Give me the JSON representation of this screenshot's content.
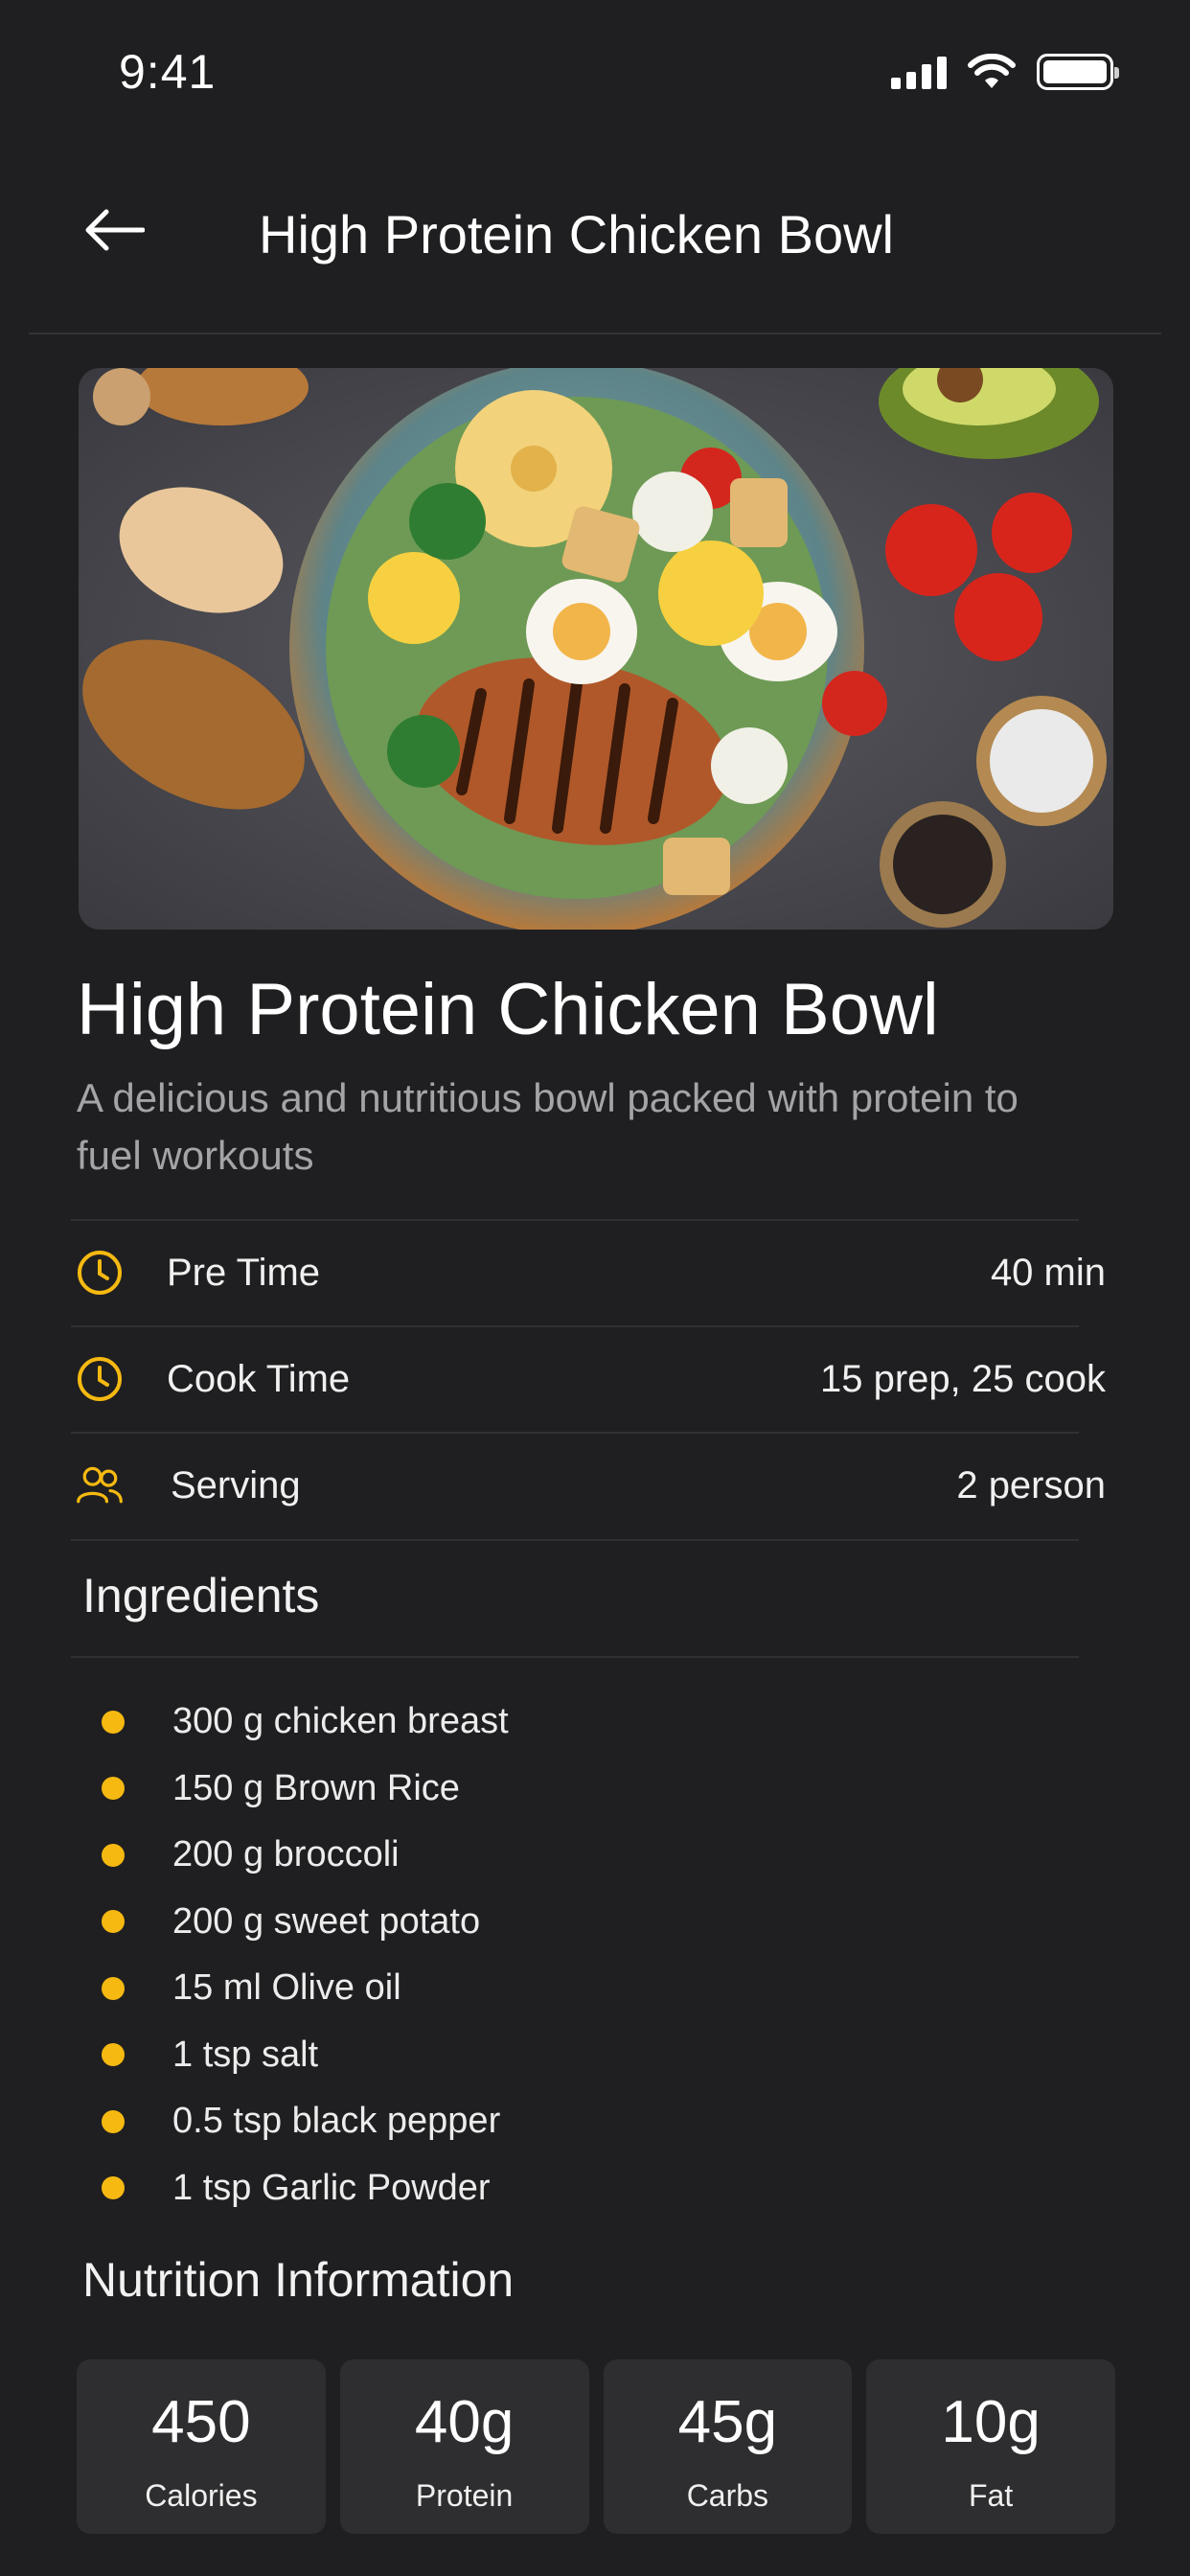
{
  "status_bar": {
    "time": "9:41"
  },
  "header": {
    "title": "High Protein Chicken Bowl"
  },
  "recipe": {
    "title": "High Protein Chicken Bowl",
    "description": "A delicious and nutritious bowl packed with protein to fuel workouts"
  },
  "info": [
    {
      "icon": "clock-icon",
      "label": "Pre Time",
      "value": "40 min"
    },
    {
      "icon": "clock-icon",
      "label": "Cook Time",
      "value": "15 prep, 25 cook"
    },
    {
      "icon": "users-icon",
      "label": "Serving",
      "value": "2 person"
    }
  ],
  "ingredients": {
    "title": "Ingredients",
    "items": [
      "300 g chicken breast",
      "150 g Brown Rice",
      "200 g broccoli",
      "200 g sweet potato",
      "15 ml Olive oil",
      "1 tsp salt",
      "0.5 tsp black pepper",
      "1 tsp Garlic Powder"
    ]
  },
  "nutrition": {
    "title": "Nutrition Information",
    "items": [
      {
        "value": "450",
        "label": "Calories"
      },
      {
        "value": "40g",
        "label": "Protein"
      },
      {
        "value": "45g",
        "label": "Carbs"
      },
      {
        "value": "10g",
        "label": "Fat"
      }
    ]
  },
  "colors": {
    "background": "#1f1f21",
    "accent": "#f6b911",
    "card": "#2e2e30",
    "muted_text": "#a4a4a8"
  }
}
